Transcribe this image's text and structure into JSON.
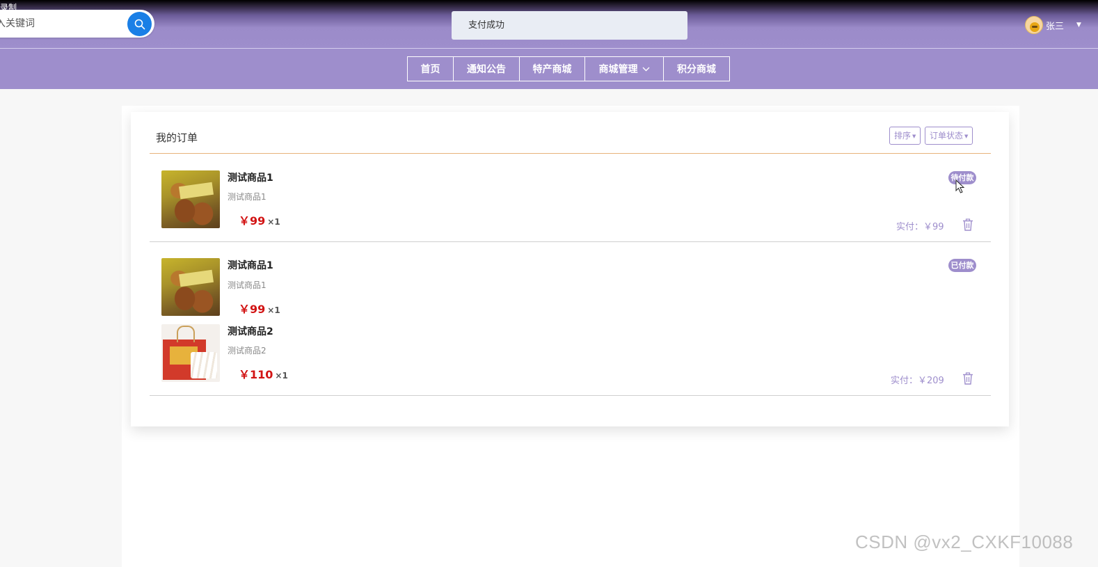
{
  "header": {
    "recording_label": "录制",
    "search": {
      "placeholder": "入关键词",
      "value": ""
    },
    "toast": "支付成功",
    "user": {
      "name": "张三"
    }
  },
  "nav": {
    "items": [
      {
        "label": "首页"
      },
      {
        "label": "通知公告"
      },
      {
        "label": "特产商城"
      },
      {
        "label": "商城管理"
      },
      {
        "label": "积分商城"
      }
    ]
  },
  "orders_page": {
    "title": "我的订单",
    "sort_label": "排序",
    "status_filter_label": "订单状态",
    "orders": [
      {
        "status": "待付款",
        "items": [
          {
            "name": "测试商品1",
            "subtitle": "测试商品1",
            "price": "￥99",
            "qty": "×1"
          }
        ],
        "paid_label": "实付：",
        "paid_amount": "￥99"
      },
      {
        "status": "已付款",
        "items": [
          {
            "name": "测试商品1",
            "subtitle": "测试商品1",
            "price": "￥99",
            "qty": "×1"
          },
          {
            "name": "测试商品2",
            "subtitle": "测试商品2",
            "price": "￥110",
            "qty": "×1"
          }
        ],
        "paid_label": "实付：",
        "paid_amount": "￥209"
      }
    ]
  },
  "watermark": "CSDN @vx2_CXKF10088",
  "colors": {
    "header_purple": "#9e8ecc",
    "price_red": "#d21414",
    "search_blue": "#1a7fe6",
    "title_underline": "#e7b37a"
  }
}
